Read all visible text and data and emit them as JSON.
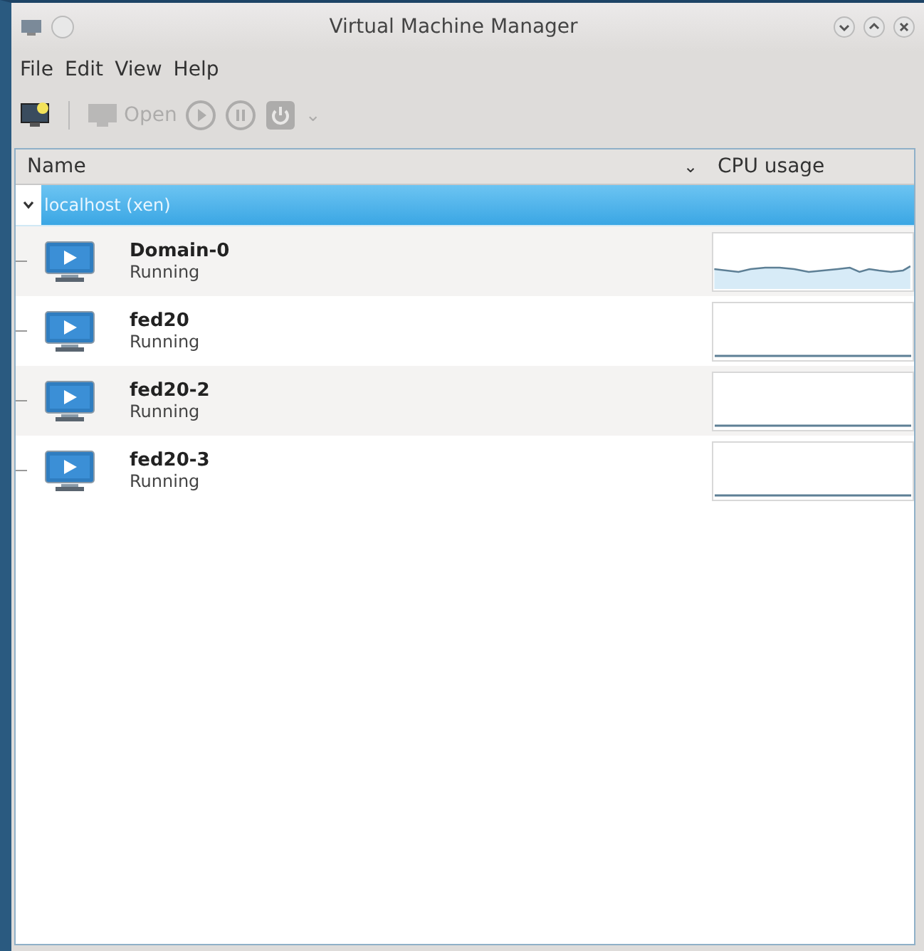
{
  "window": {
    "title": "Virtual Machine Manager"
  },
  "menu": [
    "File",
    "Edit",
    "View",
    "Help"
  ],
  "toolbar": [
    {
      "kind": "new",
      "disabled": false
    },
    {
      "kind": "open",
      "label": "Open",
      "disabled": true
    },
    {
      "kind": "run",
      "disabled": true
    },
    {
      "kind": "pause",
      "disabled": true
    },
    {
      "kind": "shutdown",
      "disabled": true
    },
    {
      "kind": "dropdown",
      "label": "⌄",
      "disabled": true
    }
  ],
  "table": {
    "columns": [
      {
        "label": "Name",
        "sort": "⌄"
      },
      {
        "label": "CPU usage"
      }
    ],
    "host": {
      "label": "localhost (xen)",
      "expanded": true,
      "selected": true,
      "children": [
        {
          "name": "Domain-0",
          "status": "Running",
          "selected": false,
          "kind": "busy"
        },
        {
          "name": "fed20",
          "status": "Running",
          "selected": false,
          "kind": "idle"
        },
        {
          "name": "fed20-2",
          "status": "Running",
          "selected": false,
          "kind": "idle"
        },
        {
          "name": "fed20-3",
          "status": "Running",
          "selected": false,
          "kind": "idle"
        }
      ]
    }
  }
}
